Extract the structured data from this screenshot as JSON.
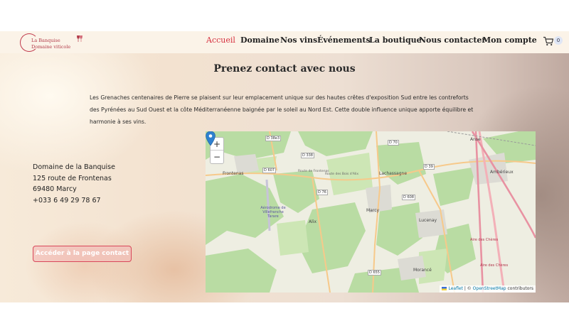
{
  "header": {
    "logo": {
      "line1": "La Banquise",
      "line2": "Domaine viticole"
    },
    "nav": [
      {
        "label": "Accueil",
        "active": true
      },
      {
        "label": "Domaine"
      },
      {
        "label": "Nos vins"
      },
      {
        "label": "Événements"
      },
      {
        "label": "La boutique"
      },
      {
        "label": "Nous contacter"
      },
      {
        "label": "Mon compte"
      }
    ],
    "cart_count": "0",
    "cart_icon": "cart-icon"
  },
  "hero": {
    "title": "Prenez contact avec nous",
    "paragraph": "Les Grenaches centenaires de Pierre se plaisent sur leur emplacement unique sur des hautes crêtes d'exposition Sud entre les contreforts des Pyrénées au Sud Ouest et  la côte Méditerranéenne baignée par le soleil au Nord Est. Cette double influence unique apporte équilibre et harmonie à ses vins.",
    "address": {
      "name": "Domaine de la Banquise",
      "street": "125 route de Frontenas",
      "city": "69480 Marcy",
      "phone": "+033 6 49 29 78 67"
    },
    "contact_button": "Accéder à la page contact"
  },
  "map": {
    "zoom_in": "+",
    "zoom_out": "−",
    "marker_icon": "map-marker-icon",
    "places": [
      "Anse",
      "Ambérieux",
      "Frontenas",
      "Lachassagne",
      "Aérodrome de Villefranche Tarare",
      "Alix",
      "Marcy",
      "Lucenay",
      "Morancé",
      "Aire des Chères",
      "Aire des Chères"
    ],
    "roads": [
      "D 38e3",
      "D 338",
      "D 70",
      "D 607",
      "D 39",
      "D 76",
      "D 608",
      "D 655"
    ],
    "road_names": [
      "Route de Frontenas",
      "Route des Bois d'Alix"
    ],
    "attribution": {
      "leaflet": "Leaflet",
      "separator": " | © ",
      "osm": "OpenStreetMap",
      "suffix": " contributors"
    },
    "colors": {
      "forest": "#b9dca3",
      "road_major": "#e892a2",
      "road_secondary": "#f7c98a"
    }
  }
}
